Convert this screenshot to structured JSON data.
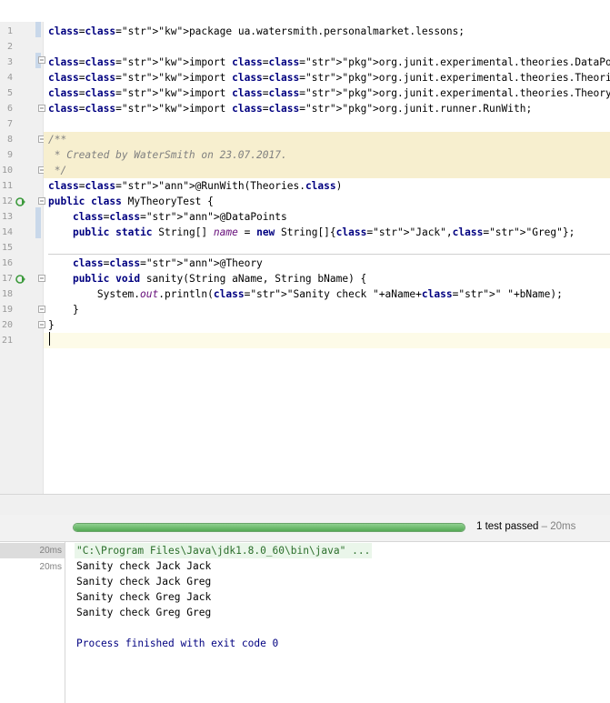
{
  "editor": {
    "lines": [
      {
        "n": "1",
        "text": "package ua.watersmith.personalmarket.lessons;"
      },
      {
        "n": "2",
        "text": ""
      },
      {
        "n": "3",
        "text": "import org.junit.experimental.theories.DataPoints;"
      },
      {
        "n": "4",
        "text": "import org.junit.experimental.theories.Theories;"
      },
      {
        "n": "5",
        "text": "import org.junit.experimental.theories.Theory;"
      },
      {
        "n": "6",
        "text": "import org.junit.runner.RunWith;"
      },
      {
        "n": "7",
        "text": ""
      },
      {
        "n": "8",
        "text": "/**"
      },
      {
        "n": "9",
        "text": " * Created by WaterSmith on 23.07.2017."
      },
      {
        "n": "10",
        "text": " */"
      },
      {
        "n": "11",
        "text": "@RunWith(Theories.class)"
      },
      {
        "n": "12",
        "text": "public class MyTheoryTest {"
      },
      {
        "n": "13",
        "text": "    @DataPoints"
      },
      {
        "n": "14",
        "text": "    public static String[] name = new String[]{\"Jack\",\"Greg\"};"
      },
      {
        "n": "15",
        "text": ""
      },
      {
        "n": "16",
        "text": "    @Theory"
      },
      {
        "n": "17",
        "text": "    public void sanity(String aName, String bName) {"
      },
      {
        "n": "18",
        "text": "        System.out.println(\"Sanity check \"+aName+\" \"+bName);"
      },
      {
        "n": "19",
        "text": "    }"
      },
      {
        "n": "20",
        "text": "}"
      },
      {
        "n": "21",
        "text": ""
      }
    ]
  },
  "run": {
    "progress_percent": 100,
    "status_text": "1 test passed",
    "status_duration": " – 20ms",
    "tree": [
      {
        "time": "20ms"
      },
      {
        "time": "20ms"
      }
    ],
    "console": {
      "command": "\"C:\\Program Files\\Java\\jdk1.8.0_60\\bin\\java\" ...",
      "output": [
        "Sanity check Jack Jack",
        "Sanity check Jack Greg",
        "Sanity check Greg Jack",
        "Sanity check Greg Greg"
      ],
      "exit": "Process finished with exit code 0"
    }
  },
  "colors": {
    "keyword": "#000080",
    "annotation": "#808000",
    "string": "#008000",
    "comment": "#808080",
    "progress": "#54a954"
  }
}
